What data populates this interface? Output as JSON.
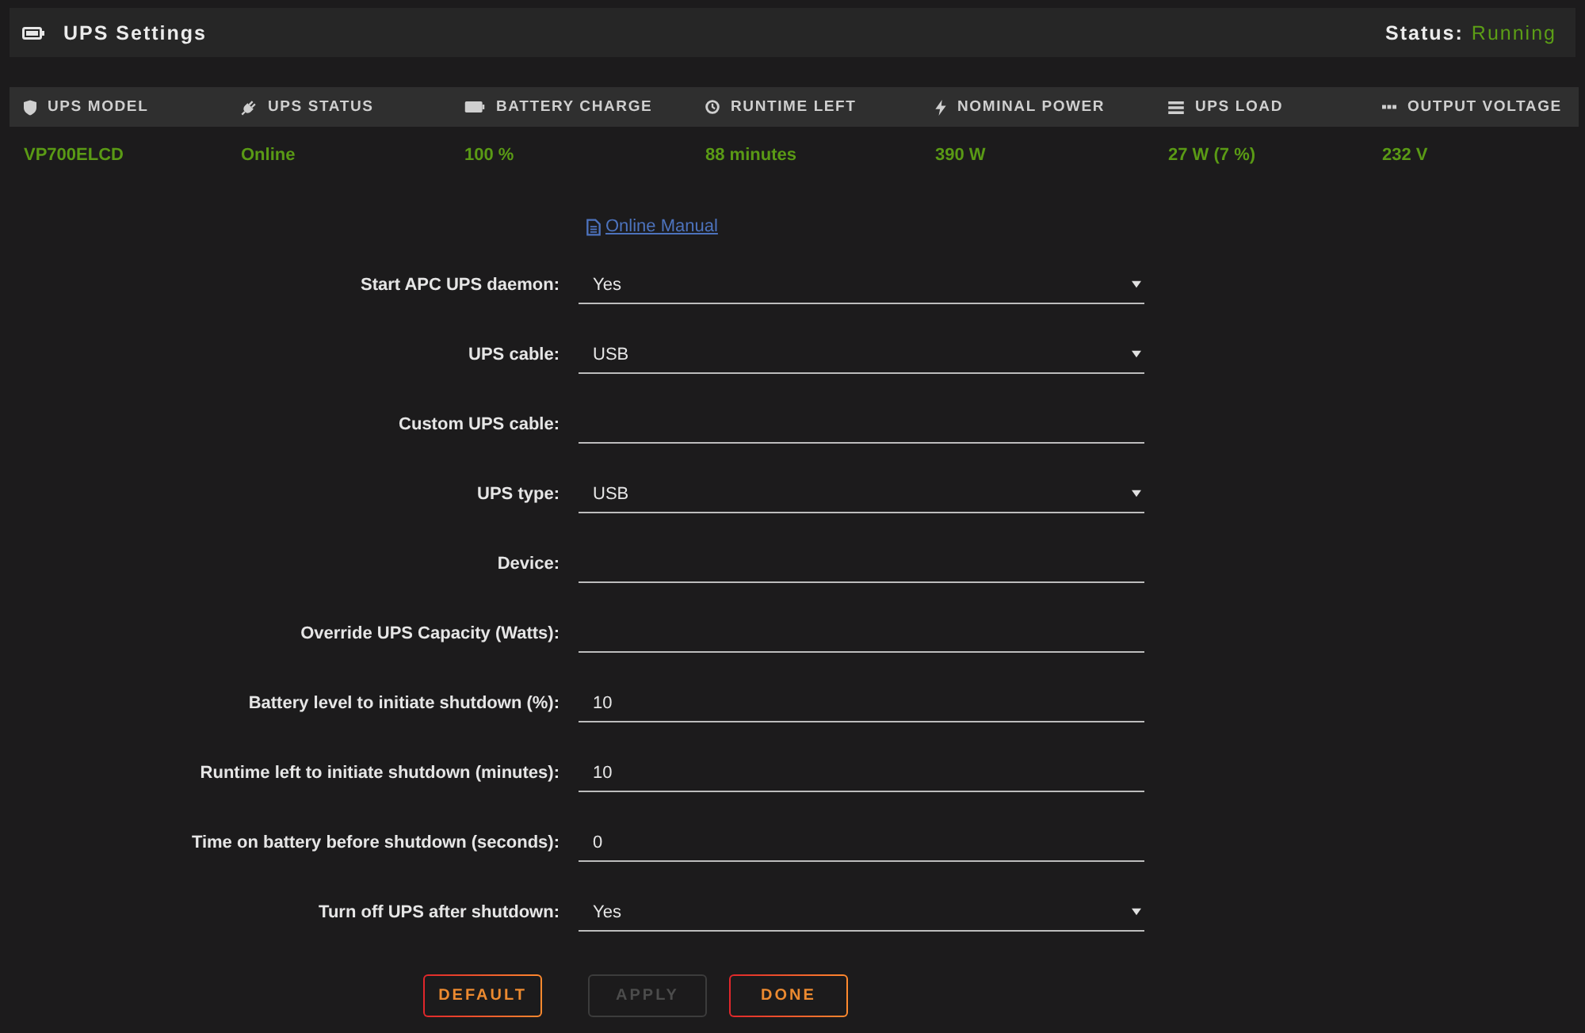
{
  "header": {
    "title": "UPS Settings",
    "status_label": "Status:",
    "status_value": "Running"
  },
  "stats": [
    {
      "label": "UPS MODEL",
      "value": "VP700ELCD"
    },
    {
      "label": "UPS STATUS",
      "value": "Online"
    },
    {
      "label": "BATTERY CHARGE",
      "value": "100 %"
    },
    {
      "label": "RUNTIME LEFT",
      "value": "88 minutes"
    },
    {
      "label": "NOMINAL POWER",
      "value": "390 W"
    },
    {
      "label": "UPS LOAD",
      "value": "27 W (7 %)"
    },
    {
      "label": "OUTPUT VOLTAGE",
      "value": "232 V"
    }
  ],
  "manual_link": "Online Manual",
  "form": [
    {
      "kind": "select",
      "label": "Start APC UPS daemon:",
      "value": "Yes"
    },
    {
      "kind": "select",
      "label": "UPS cable:",
      "value": "USB"
    },
    {
      "kind": "text",
      "label": "Custom UPS cable:"
    },
    {
      "kind": "select",
      "label": "UPS type:",
      "value": "USB"
    },
    {
      "kind": "text",
      "label": "Device:"
    },
    {
      "kind": "text",
      "label": "Override UPS Capacity (Watts):"
    },
    {
      "kind": "text",
      "label": "Battery level to initiate shutdown (%):",
      "value": "10"
    },
    {
      "kind": "text",
      "label": "Runtime left to initiate shutdown (minutes):",
      "value": "10"
    },
    {
      "kind": "text",
      "label": "Time on battery before shutdown (seconds):",
      "value": "0"
    },
    {
      "kind": "select",
      "label": "Turn off UPS after shutdown:",
      "value": "Yes"
    }
  ],
  "buttons": [
    {
      "label": "DEFAULT",
      "disabled": false
    },
    {
      "label": "APPLY",
      "disabled": true
    },
    {
      "label": "DONE",
      "disabled": false
    }
  ]
}
